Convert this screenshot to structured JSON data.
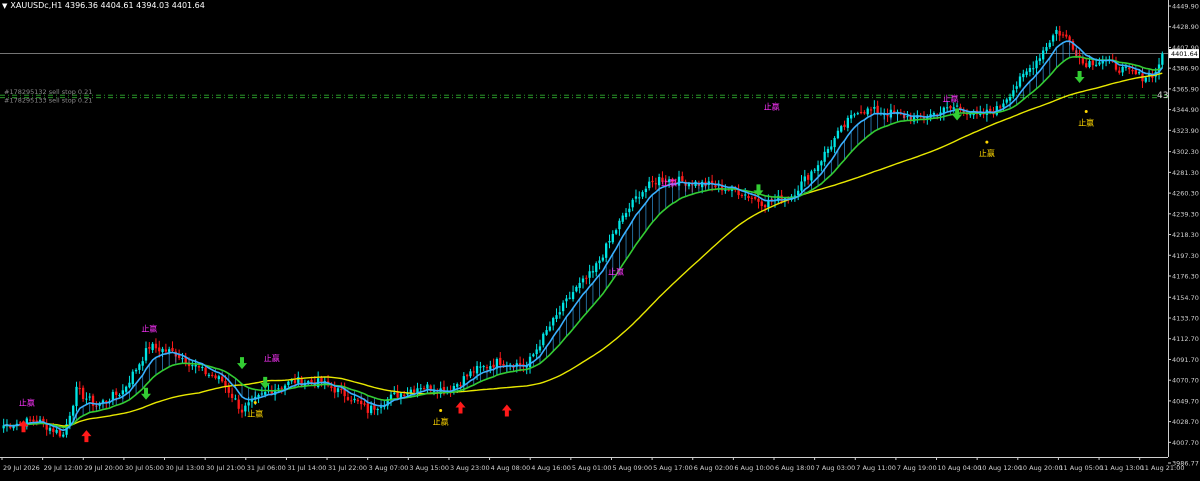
{
  "header": {
    "symbol_label": "XAUUSDc,H1",
    "ohlc": "4396.36 4404.61 4394.03 4401.64",
    "dropdown_icon": "triangle-down-icon"
  },
  "colors": {
    "background": "#000000",
    "bull": "#00e5e5",
    "bear": "#ff1a1a",
    "ma_fast": "#3ab0ff",
    "ma_mid": "#33cc33",
    "ma_slow": "#e8e800",
    "marker_magenta": "#ff33ff",
    "marker_yellow": "#ffd700",
    "price_line": "#9a9a9a",
    "stop_line": "#2fae2f",
    "axis_text": "#d0d0d0",
    "price_label_bg": "#ffffff"
  },
  "orders": {
    "buy_stop_label": "#178295132 sell stop 0.21",
    "buy_stop_label_2": "#178295133 sell stop 0.21",
    "edge_label": "43"
  },
  "markers": {
    "label": "止赢"
  },
  "chart_data": {
    "type": "candlestick",
    "symbol": "XAUUSDc",
    "timeframe": "H1",
    "current_price": 4401.64,
    "ylim": [
      3986.77,
      4455.0
    ],
    "y_ticks": [
      4449.9,
      4428.9,
      4407.9,
      4386.9,
      4365.9,
      4344.9,
      4323.9,
      4302.3,
      4281.3,
      4260.3,
      4239.3,
      4218.3,
      4197.3,
      4176.3,
      4154.7,
      4133.7,
      4112.7,
      4091.7,
      4070.7,
      4049.7,
      4028.7,
      4007.7,
      3986.77
    ],
    "x_ticks": [
      "29 Jul 2026",
      "29 Jul 12:00",
      "29 Jul 20:00",
      "30 Jul 05:00",
      "30 Jul 13:00",
      "30 Jul 21:00",
      "31 Jul 06:00",
      "31 Jul 14:00",
      "31 Jul 22:00",
      "3 Aug 07:00",
      "3 Aug 15:00",
      "3 Aug 23:00",
      "4 Aug 08:00",
      "4 Aug 16:00",
      "5 Aug 01:00",
      "5 Aug 09:00",
      "5 Aug 17:00",
      "6 Aug 02:00",
      "6 Aug 10:00",
      "6 Aug 18:00",
      "7 Aug 03:00",
      "7 Aug 11:00",
      "7 Aug 19:00",
      "10 Aug 04:00",
      "10 Aug 12:00",
      "10 Aug 20:00",
      "11 Aug 05:00",
      "11 Aug 13:00",
      "11 Aug 21:00"
    ],
    "order_levels": [
      4359.5,
      4357.0
    ],
    "anchors": [
      [
        0,
        4025
      ],
      [
        10,
        4030
      ],
      [
        18,
        4015
      ],
      [
        22,
        4060
      ],
      [
        28,
        4045
      ],
      [
        36,
        4060
      ],
      [
        44,
        4105
      ],
      [
        52,
        4098
      ],
      [
        60,
        4080
      ],
      [
        66,
        4070
      ],
      [
        72,
        4040
      ],
      [
        80,
        4060
      ],
      [
        88,
        4070
      ],
      [
        96,
        4068
      ],
      [
        104,
        4055
      ],
      [
        110,
        4040
      ],
      [
        118,
        4055
      ],
      [
        126,
        4065
      ],
      [
        134,
        4060
      ],
      [
        142,
        4080
      ],
      [
        150,
        4090
      ],
      [
        158,
        4085
      ],
      [
        164,
        4120
      ],
      [
        172,
        4160
      ],
      [
        178,
        4180
      ],
      [
        186,
        4230
      ],
      [
        192,
        4260
      ],
      [
        198,
        4275
      ],
      [
        206,
        4272
      ],
      [
        214,
        4268
      ],
      [
        222,
        4262
      ],
      [
        230,
        4250
      ],
      [
        238,
        4258
      ],
      [
        246,
        4290
      ],
      [
        252,
        4320
      ],
      [
        258,
        4345
      ],
      [
        264,
        4343
      ],
      [
        270,
        4340
      ],
      [
        276,
        4335
      ],
      [
        282,
        4342
      ],
      [
        288,
        4348
      ],
      [
        294,
        4338
      ],
      [
        300,
        4345
      ],
      [
        306,
        4370
      ],
      [
        312,
        4395
      ],
      [
        318,
        4425
      ],
      [
        322,
        4415
      ],
      [
        326,
        4392
      ],
      [
        332,
        4395
      ],
      [
        338,
        4385
      ],
      [
        344,
        4378
      ],
      [
        348,
        4382
      ],
      [
        350,
        4401.64
      ]
    ],
    "signals": [
      {
        "type": "take-profit",
        "label": "止赢",
        "bar": 7,
        "price": 4045,
        "pos": "above"
      },
      {
        "type": "take-profit",
        "label": "止赢",
        "bar": 44,
        "price": 4120,
        "pos": "above"
      },
      {
        "type": "take-profit",
        "label": "止赢",
        "bar": 76,
        "price": 4048,
        "pos": "below"
      },
      {
        "type": "take-profit",
        "label": "止赢",
        "bar": 81,
        "price": 4090,
        "pos": "above"
      },
      {
        "type": "take-profit",
        "label": "止赢",
        "bar": 132,
        "price": 4040,
        "pos": "below"
      },
      {
        "type": "take-profit",
        "label": "止赢",
        "bar": 185,
        "price": 4178,
        "pos": "above"
      },
      {
        "type": "take-profit",
        "label": "止赢",
        "bar": 201,
        "price": 4268,
        "pos": "above"
      },
      {
        "type": "take-profit",
        "label": "止赢",
        "bar": 232,
        "price": 4345,
        "pos": "above"
      },
      {
        "type": "take-profit",
        "label": "止赢",
        "bar": 286,
        "price": 4353,
        "pos": "above"
      },
      {
        "type": "take-profit",
        "label": "止赢",
        "bar": 297,
        "price": 4312,
        "pos": "below"
      },
      {
        "type": "take-profit",
        "label": "止赢",
        "bar": 327,
        "price": 4343,
        "pos": "below"
      }
    ],
    "arrows": [
      {
        "dir": "up",
        "bar": 6,
        "price": 4024
      },
      {
        "dir": "up",
        "bar": 25,
        "price": 4014
      },
      {
        "dir": "up",
        "bar": 138,
        "price": 4043
      },
      {
        "dir": "up",
        "bar": 152,
        "price": 4040
      },
      {
        "dir": "down",
        "bar": 43,
        "price": 4057
      },
      {
        "dir": "down",
        "bar": 72,
        "price": 4088
      },
      {
        "dir": "down",
        "bar": 79,
        "price": 4068
      },
      {
        "dir": "down",
        "bar": 228,
        "price": 4263
      },
      {
        "dir": "down",
        "bar": 288,
        "price": 4340
      },
      {
        "dir": "down",
        "bar": 325,
        "price": 4378
      }
    ]
  }
}
